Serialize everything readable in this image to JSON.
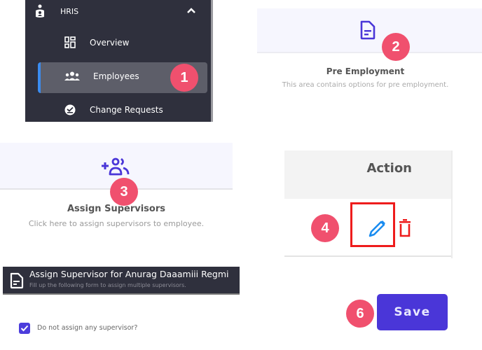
{
  "steps": [
    "1",
    "2",
    "3",
    "4",
    "6"
  ],
  "sidebar": {
    "section_label": "HRIS",
    "items": [
      {
        "label": "Overview",
        "icon": "dashboard-icon"
      },
      {
        "label": "Employees",
        "icon": "users-icon",
        "active": true
      },
      {
        "label": "Change Requests",
        "icon": "check-circle-icon"
      }
    ]
  },
  "pre_employment": {
    "title": "Pre Employment",
    "description": "This area contains options for pre employment."
  },
  "assign_supervisors": {
    "title": "Assign Supervisors",
    "description": "Click here to assign supervisors to employee."
  },
  "table": {
    "column_header": "Action",
    "actions": [
      "edit",
      "delete"
    ]
  },
  "form": {
    "title": "Assign Supervisor for Anurag Daaamiii Regmi",
    "subtitle": "Fill up the following form to assign multiple supervisors.",
    "checkbox_label": "Do not assign any supervisor?",
    "checkbox_checked": true
  },
  "save_label": "Save",
  "colors": {
    "accent": "#4a36d8",
    "badge": "#f0506e",
    "sidebar_bg": "#2f303d",
    "active_indicator": "#3b8cf0",
    "edit_icon": "#1a8cf0",
    "delete_icon": "#ee1c1c"
  }
}
